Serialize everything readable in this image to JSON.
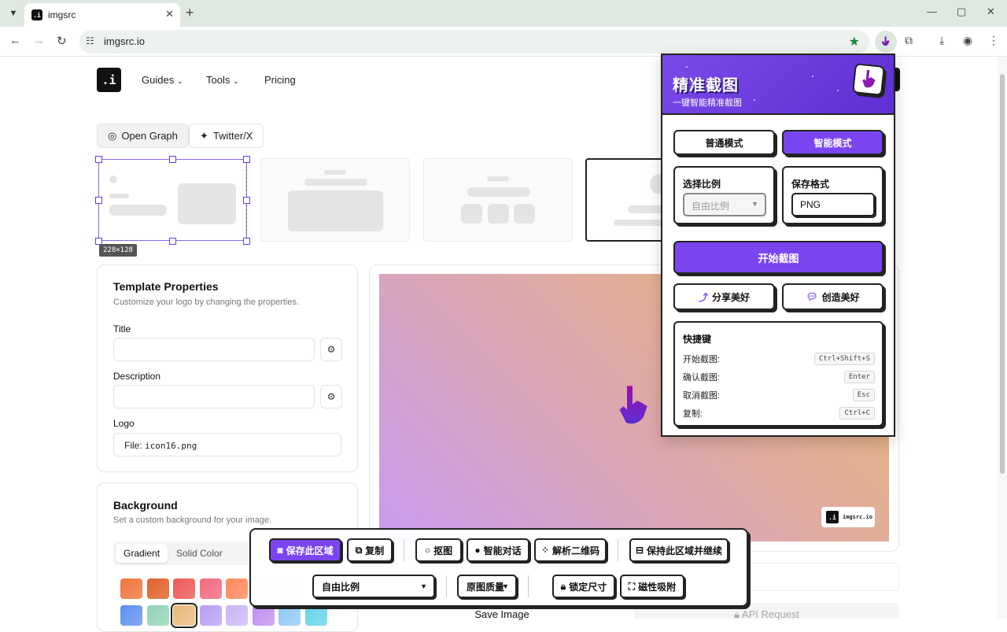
{
  "browser": {
    "tab_title": "imgsrc",
    "url": "imgsrc.io",
    "favicon_text": ".i"
  },
  "page": {
    "logo_text": ".i",
    "nav": [
      {
        "label": "Guides",
        "dropdown": true
      },
      {
        "label": "Tools",
        "dropdown": true
      },
      {
        "label": "Pricing",
        "dropdown": false
      }
    ],
    "mode_tabs": [
      "Open Graph",
      "Twitter/X"
    ],
    "selection_size": "228×128",
    "template_properties": {
      "title": "Template Properties",
      "subtitle": "Customize your logo by changing the properties.",
      "title_label": "Title",
      "description_label": "Description",
      "logo_label": "Logo",
      "logo_file_prefix": "File:",
      "logo_file_name": "icon16.png"
    },
    "background": {
      "title": "Background",
      "subtitle": "Set a custom background for your image.",
      "tabs": [
        "Gradient",
        "Solid Color"
      ],
      "active_tab": "Gradient"
    },
    "preview_badge_text": "imgsrc.io",
    "save_button": "Save Image",
    "api_button": "API Request"
  },
  "popup": {
    "title": "精准截图",
    "subtitle": "一键智能精准截图",
    "modes": [
      "普通模式",
      "智能模式"
    ],
    "active_mode": "智能模式",
    "ratio_label": "选择比例",
    "ratio_value": "自由比例",
    "format_label": "保存格式",
    "format_value": "PNG",
    "start_button": "开始截图",
    "share_button": "分享美好",
    "create_button": "创造美好",
    "shortcuts_title": "快捷键",
    "shortcuts": [
      {
        "label": "开始截图:",
        "key": "Ctrl+Shift+S"
      },
      {
        "label": "确认截图:",
        "key": "Enter"
      },
      {
        "label": "取消截图:",
        "key": "Esc"
      },
      {
        "label": "复制:",
        "key": "Ctrl+C"
      }
    ]
  },
  "capture_toolbar": {
    "save_region": "保存此区域",
    "copy": "复制",
    "cutout": "抠图",
    "chat": "智能对话",
    "qr": "解析二维码",
    "keep_continue": "保持此区域并继续",
    "ratio": "自由比例",
    "quality": "原图质量",
    "lock_size": "锁定尺寸",
    "magnet": "磁性吸附"
  },
  "colors": {
    "accent_purple": "#7a45f0",
    "selection_handle": "#6a3de8",
    "star_green": "#1a8a3c",
    "swatches_row1": [
      "#f0763f",
      "#e0622a",
      "#ef5a5a",
      "#f26b80",
      "#ff8a5c",
      "#f9d2c7",
      "#f7c8cf"
    ],
    "swatches_row2": [
      "#5b8def",
      "#8fd3b6",
      "#e9b876",
      "#b79cf5",
      "#c9b4f7",
      "#c08cf0",
      "#8cc8f7",
      "#5fd3e8"
    ]
  }
}
